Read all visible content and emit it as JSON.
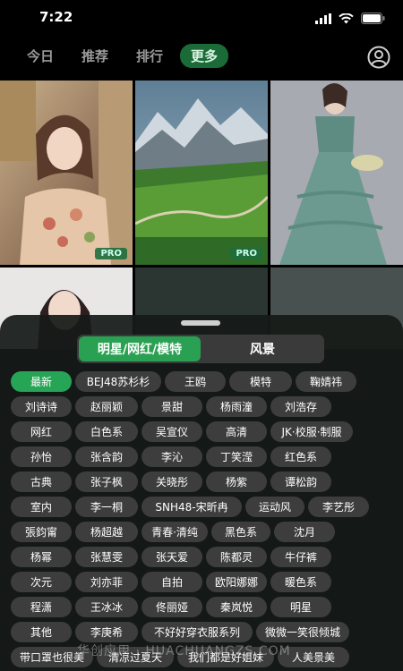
{
  "status": {
    "time": "7:22"
  },
  "nav": {
    "tabs": [
      "今日",
      "推荐",
      "排行",
      "更多"
    ],
    "active_tab": "更多"
  },
  "grid": {
    "badge": "PRO"
  },
  "sheet": {
    "segments": [
      "明星/网红/模特",
      "风景"
    ],
    "active_segment": "明星/网红/模特",
    "chips": [
      [
        "最新",
        "BEJ48苏杉杉",
        "王鸥",
        "模特",
        "鞠婧祎"
      ],
      [
        "刘诗诗",
        "赵丽颖",
        "景甜",
        "杨雨潼",
        "刘浩存"
      ],
      [
        "网红",
        "白色系",
        "吴宣仪",
        "高清",
        "JK·校服·制服"
      ],
      [
        "孙怡",
        "张含韵",
        "李沁",
        "丁笑滢",
        "红色系"
      ],
      [
        "古典",
        "张子枫",
        "关晓彤",
        "杨紫",
        "谭松韵"
      ],
      [
        "室内",
        "李一桐",
        "SNH48-宋昕冉",
        "运动风",
        "李艺彤"
      ],
      [
        "張鈞甯",
        "杨超越",
        "青春·清纯",
        "黑色系",
        "沈月"
      ],
      [
        "杨幂",
        "张慧雯",
        "张天爱",
        "陈都灵",
        "牛仔裤"
      ],
      [
        "次元",
        "刘亦菲",
        "自拍",
        "欧阳娜娜",
        "暖色系"
      ],
      [
        "程潇",
        "王冰冰",
        "佟丽娅",
        "秦岚悦",
        "明星"
      ],
      [
        "其他",
        "李庚希",
        "不好好穿衣服系列",
        "微微一笑很倾城"
      ],
      [
        "带口罩也很美",
        "清凉过夏天",
        "我们都是好姐妹",
        "人美景美"
      ]
    ],
    "active_chip": "最新"
  },
  "watermark": "华创应用 · HUACHUANGZS.COM"
}
